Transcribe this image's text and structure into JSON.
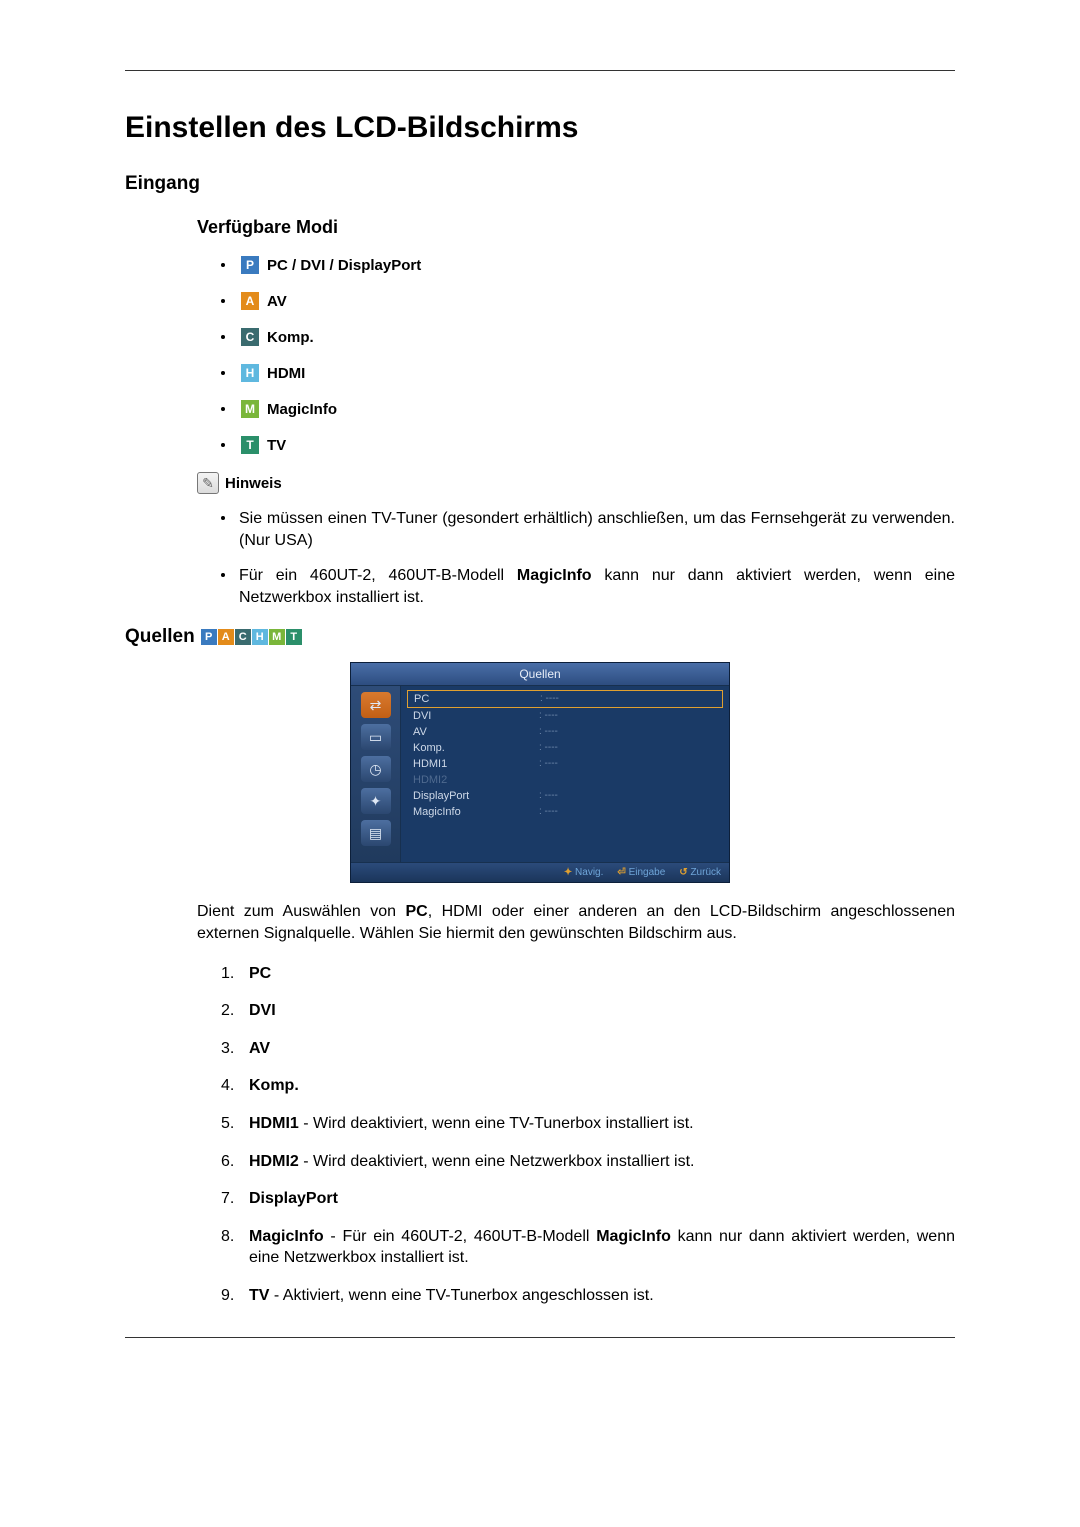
{
  "title": "Einstellen des LCD-Bildschirms",
  "section_eingang": "Eingang",
  "subsection_modi": "Verfügbare Modi",
  "modes": {
    "p": {
      "letter": "P",
      "label": "PC / DVI / DisplayPort"
    },
    "a": {
      "letter": "A",
      "label": "AV"
    },
    "c": {
      "letter": "C",
      "label": "Komp."
    },
    "h": {
      "letter": "H",
      "label": "HDMI"
    },
    "m": {
      "letter": "M",
      "label": "MagicInfo"
    },
    "t": {
      "letter": "T",
      "label": "TV"
    }
  },
  "hinweis_label": "Hinweis",
  "notes": {
    "n1": "Sie müssen einen TV-Tuner (gesondert erhältlich) anschließen, um das Fernsehgerät zu verwenden. (Nur USA)",
    "n2_pre": "Für ein 460UT-2, 460UT-B-Modell ",
    "n2_bold": "MagicInfo",
    "n2_post": " kann nur dann aktiviert werden, wenn eine Netzwerkbox installiert ist."
  },
  "quellen_heading": "Quellen",
  "osd": {
    "title": "Quellen",
    "rows": {
      "r0": {
        "name": "PC",
        "val": ": ----"
      },
      "r1": {
        "name": "DVI",
        "val": ": ----"
      },
      "r2": {
        "name": "AV",
        "val": ": ----"
      },
      "r3": {
        "name": "Komp.",
        "val": ": ----"
      },
      "r4": {
        "name": "HDMI1",
        "val": ": ----"
      },
      "r5": {
        "name": "HDMI2",
        "val": ""
      },
      "r6": {
        "name": "DisplayPort",
        "val": ": ----"
      },
      "r7": {
        "name": "MagicInfo",
        "val": ": ----"
      }
    },
    "footer": {
      "f1": "Navig.",
      "f2": "Eingabe",
      "f3": "Zurück"
    }
  },
  "desc_pre": "Dient zum Auswählen von ",
  "desc_bold": "PC",
  "desc_post": ", HDMI oder einer anderen an den LCD-Bildschirm angeschlossenen externen Signalquelle. Wählen Sie hiermit den gewünschten Bildschirm aus.",
  "sources": {
    "s1": "PC",
    "s2": "DVI",
    "s3": "AV",
    "s4": "Komp.",
    "s5_b": "HDMI1",
    "s5_t": " - Wird deaktiviert, wenn eine TV-Tunerbox installiert ist.",
    "s6_b": "HDMI2",
    "s6_t": " - Wird deaktiviert, wenn eine Netzwerkbox installiert ist.",
    "s7": "DisplayPort",
    "s8_b1": "MagicInfo",
    "s8_t1": " - Für ein 460UT-2, 460UT-B-Modell ",
    "s8_b2": "MagicInfo",
    "s8_t2": " kann nur dann aktiviert werden, wenn eine Netzwerkbox installiert ist.",
    "s9_b": "TV",
    "s9_t": " - Aktiviert, wenn eine TV-Tunerbox angeschlossen ist."
  }
}
